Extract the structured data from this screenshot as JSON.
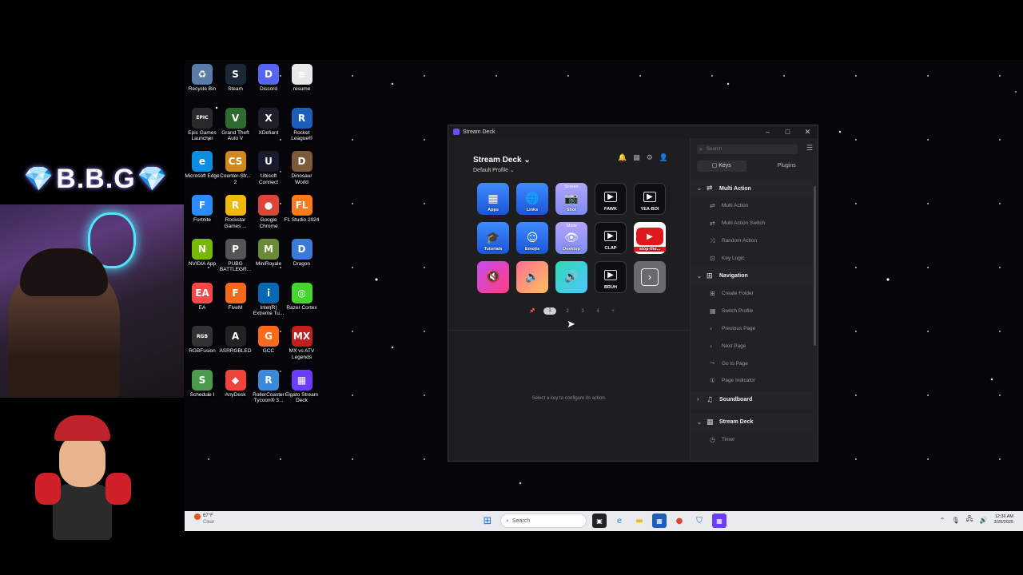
{
  "overlay": {
    "brand_text": "B.B.G",
    "gem_glyph": "💎"
  },
  "desktop": {
    "icons": [
      {
        "label": "Recycle Bin",
        "glyph": "♻",
        "color": "#5a7da8"
      },
      {
        "label": "Steam",
        "glyph": "S",
        "color": "#1b2838"
      },
      {
        "label": "Discord",
        "glyph": "D",
        "color": "#5865f2"
      },
      {
        "label": "resume",
        "glyph": "≡",
        "color": "#e8e8e8"
      },
      {
        "label": "Epic Games Launcher",
        "glyph": "EPIC",
        "color": "#2a2a2a"
      },
      {
        "label": "Grand Theft Auto V",
        "glyph": "V",
        "color": "#2f6b2f"
      },
      {
        "label": "XDefiant",
        "glyph": "X",
        "color": "#1e1e2a"
      },
      {
        "label": "Rocket League®",
        "glyph": "R",
        "color": "#1d5fb8"
      },
      {
        "label": "Microsoft Edge",
        "glyph": "e",
        "color": "#0c8ee0"
      },
      {
        "label": "Counter-Str... 2",
        "glyph": "CS",
        "color": "#d08a1c"
      },
      {
        "label": "Ubisoft Connect",
        "glyph": "U",
        "color": "#1a1a2e"
      },
      {
        "label": "Dinosaur World",
        "glyph": "D",
        "color": "#7a5a3a"
      },
      {
        "label": "Fortnite",
        "glyph": "F",
        "color": "#2a8cff"
      },
      {
        "label": "Rockstar Games ...",
        "glyph": "R",
        "color": "#f2b90d"
      },
      {
        "label": "Google Chrome",
        "glyph": "●",
        "color": "#db4437"
      },
      {
        "label": "FL Studio 2024",
        "glyph": "FL",
        "color": "#ff7a1a"
      },
      {
        "label": "NVIDIA App",
        "glyph": "N",
        "color": "#76b900"
      },
      {
        "label": "PUBG BATTLEGR...",
        "glyph": "P",
        "color": "#555"
      },
      {
        "label": "MiniRoyale",
        "glyph": "M",
        "color": "#6a8a3a"
      },
      {
        "label": "Dragon",
        "glyph": "D",
        "color": "#3a7ad8"
      },
      {
        "label": "EA",
        "glyph": "EA",
        "color": "#ff4747"
      },
      {
        "label": "FiveM",
        "glyph": "F",
        "color": "#f26b1d"
      },
      {
        "label": "Intel(R) Extreme Tu...",
        "glyph": "i",
        "color": "#0068b5"
      },
      {
        "label": "Razer Cortex",
        "glyph": "◎",
        "color": "#44d62c"
      },
      {
        "label": "RGBFusion",
        "glyph": "RGB",
        "color": "#333"
      },
      {
        "label": "ASRRGBLED",
        "glyph": "A",
        "color": "#222"
      },
      {
        "label": "GCC",
        "glyph": "G",
        "color": "#ff6a1a"
      },
      {
        "label": "MX vs ATV Legends",
        "glyph": "MX",
        "color": "#c41e1e"
      },
      {
        "label": "Schedule I",
        "glyph": "S",
        "color": "#4c9a4c"
      },
      {
        "label": "AnyDesk",
        "glyph": "◆",
        "color": "#ef443b"
      },
      {
        "label": "RollerCoaster Tycoon® 3...",
        "glyph": "R",
        "color": "#3a8ad8"
      },
      {
        "label": "Elgato Stream Deck",
        "glyph": "▦",
        "color": "#6c3cff"
      }
    ]
  },
  "window": {
    "title": "Stream Deck",
    "minimize": "–",
    "maximize": "□",
    "close": "✕"
  },
  "deck": {
    "title": "Stream Deck ⌄",
    "profile": "Default Profile ⌄",
    "icons": {
      "bell": "🔔",
      "store": "▦",
      "settings": "⚙",
      "account": "👤"
    },
    "keys": [
      {
        "label": "Apps",
        "top": "",
        "glyph": "▦",
        "style": "blue"
      },
      {
        "label": "Links",
        "top": "",
        "glyph": "🌐",
        "style": "blue"
      },
      {
        "label": "Shot",
        "top": "Screen",
        "glyph": "📷",
        "style": "lav"
      },
      {
        "label": "FAWK",
        "top": "",
        "glyph": "▶",
        "style": "dark"
      },
      {
        "label": "YEA-BOI",
        "top": "",
        "glyph": "▶",
        "style": "dark"
      },
      {
        "label": "Tutorials",
        "top": "",
        "glyph": "🎓",
        "style": "blue"
      },
      {
        "label": "Emojis",
        "top": "",
        "glyph": "☺",
        "style": "blue"
      },
      {
        "label": "Desktop",
        "top": "Show",
        "glyph": "👁",
        "style": "lav"
      },
      {
        "label": "CLAP",
        "top": "",
        "glyph": "▶",
        "style": "dark"
      },
      {
        "label": "stop-the...",
        "top": "",
        "glyph": "▶",
        "style": "red"
      },
      {
        "label": "",
        "top": "",
        "glyph": "🔇",
        "style": "mag"
      },
      {
        "label": "",
        "top": "",
        "glyph": "🔉",
        "style": "sun"
      },
      {
        "label": "",
        "top": "",
        "glyph": "🔊",
        "style": "aqua"
      },
      {
        "label": "BRUH",
        "top": "",
        "glyph": "▶",
        "style": "dark"
      },
      {
        "label": "",
        "top": "",
        "glyph": "›",
        "style": "grey"
      }
    ],
    "pager": {
      "pin": "📌",
      "pages": [
        "1",
        "2",
        "3",
        "4"
      ],
      "active": "1",
      "add": "+"
    },
    "hint": "Select a key to configure its action."
  },
  "panel": {
    "search_placeholder": "Search",
    "tabs": [
      "Keys",
      "Plugins"
    ],
    "active_tab": "Keys",
    "categories": [
      {
        "name": "Multi Action",
        "expanded": true,
        "chevron": "⌄",
        "items": [
          "Multi Action",
          "Multi Action Switch",
          "Random Action",
          "Key Logic"
        ]
      },
      {
        "name": "Navigation",
        "expanded": true,
        "chevron": "⌄",
        "items": [
          "Create Folder",
          "Switch Profile",
          "Previous Page",
          "Next Page",
          "Go to Page",
          "Page Indicator"
        ]
      },
      {
        "name": "Soundboard",
        "expanded": false,
        "chevron": "›",
        "items": []
      },
      {
        "name": "Stream Deck",
        "expanded": true,
        "chevron": "⌄",
        "items": [
          "Timer"
        ]
      }
    ]
  },
  "taskbar": {
    "weather_temp": "67°F",
    "weather_desc": "Clear",
    "search_label": "Search",
    "time": "12:36 AM",
    "date": "3/20/2025"
  },
  "colors": {
    "accent": "#6c4cff",
    "window_bg": "#1e1e20",
    "taskbar_bg": "#e9ebef"
  }
}
